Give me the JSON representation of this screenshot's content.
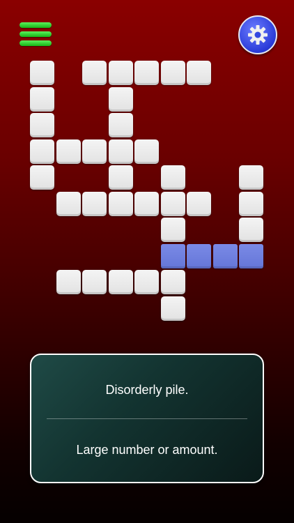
{
  "header": {
    "menu_icon": "hamburger-menu-icon",
    "settings_icon": "gear-icon",
    "menu_color": "#2ed62e",
    "settings_color": "#3447e0"
  },
  "board": {
    "tile_color": "#e9e9e9",
    "selected_color": "#6f80e0",
    "tiles": [
      [
        1,
        0,
        1,
        1,
        1,
        1,
        1,
        0,
        0
      ],
      [
        1,
        0,
        0,
        1,
        0,
        0,
        0,
        0,
        0
      ],
      [
        1,
        0,
        0,
        1,
        0,
        0,
        0,
        0,
        0
      ],
      [
        1,
        1,
        1,
        1,
        1,
        0,
        0,
        0,
        0
      ],
      [
        1,
        0,
        0,
        1,
        0,
        1,
        0,
        0,
        1
      ],
      [
        0,
        1,
        1,
        1,
        1,
        1,
        1,
        0,
        1
      ],
      [
        0,
        0,
        0,
        0,
        0,
        1,
        0,
        0,
        1
      ],
      [
        0,
        0,
        0,
        0,
        0,
        2,
        2,
        2,
        2
      ],
      [
        0,
        1,
        1,
        1,
        1,
        1,
        0,
        0,
        0
      ],
      [
        0,
        0,
        0,
        0,
        0,
        1,
        0,
        0,
        0
      ]
    ]
  },
  "clues": {
    "clue_1": "Disorderly pile.",
    "clue_2": "Large number or amount."
  }
}
